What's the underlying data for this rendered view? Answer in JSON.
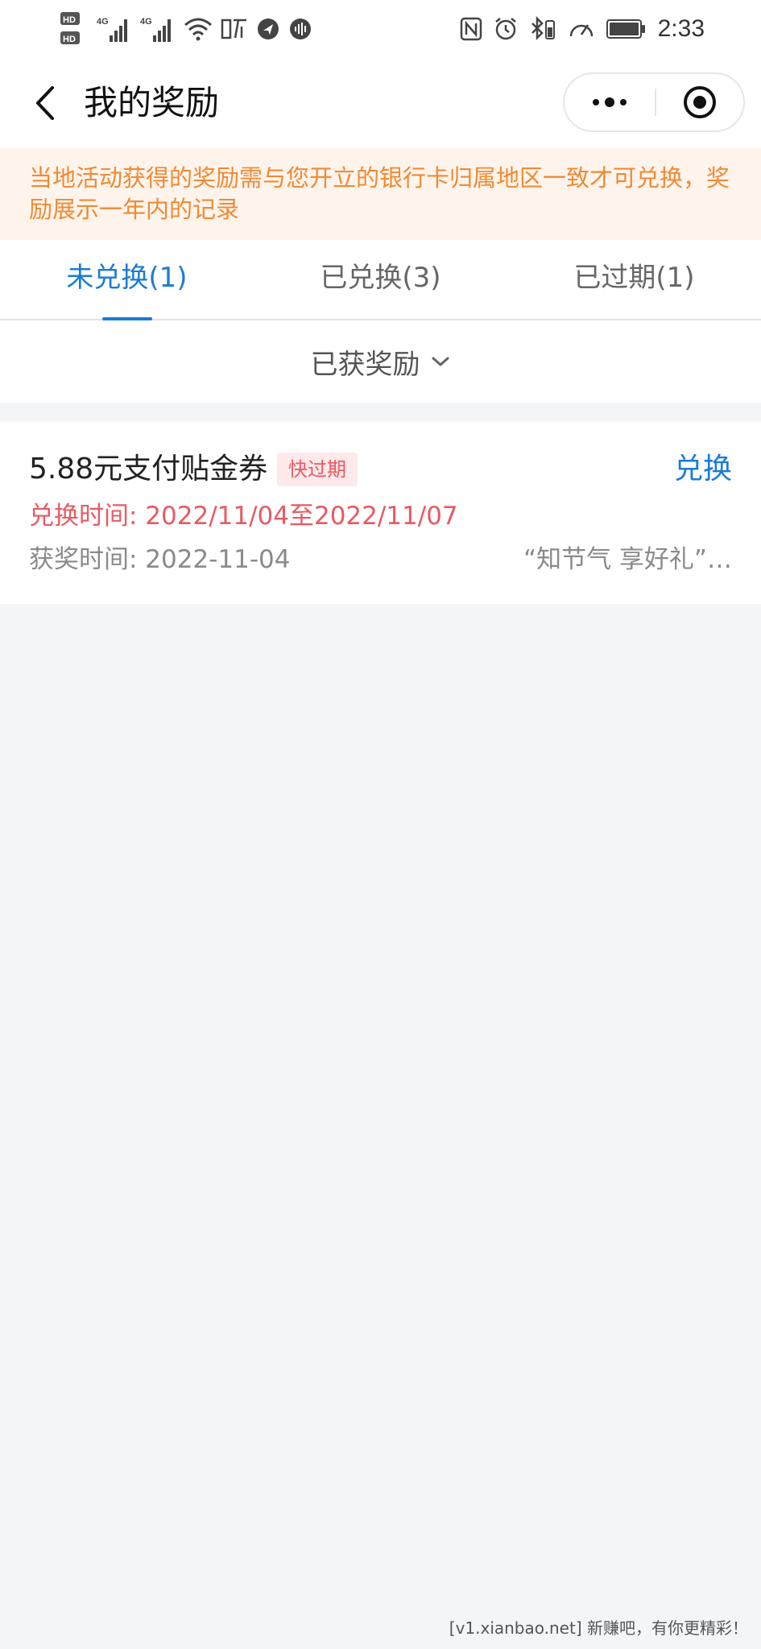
{
  "status_bar": {
    "time": "2:33",
    "signal_labels": [
      "HD",
      "HD"
    ],
    "network_labels": [
      "4G",
      "4G"
    ]
  },
  "nav": {
    "title": "我的奖励"
  },
  "notice": {
    "text": "当地活动获得的奖励需与您开立的银行卡归属地区一致才可兑换，奖励展示一年内的记录"
  },
  "tabs": [
    {
      "label": "未兑换(1)",
      "active": true
    },
    {
      "label": "已兑换(3)",
      "active": false
    },
    {
      "label": "已过期(1)",
      "active": false
    }
  ],
  "filter": {
    "label": "已获奖励"
  },
  "rewards": [
    {
      "title": "5.88元支付贴金券",
      "badge": "快过期",
      "action": "兑换",
      "redeem_time": "兑换时间: 2022/11/04至2022/11/07",
      "award_time": "获奖时间: 2022-11-04",
      "activity": "“知节气 享好礼”…"
    }
  ],
  "watermark": "[v1.xianbao.net] 新赚吧，有你更精彩！",
  "colors": {
    "accent": "#1a7bd6",
    "warning": "#e85a63",
    "notice_text": "#f08a33",
    "notice_bg": "#fff4ec",
    "page_bg": "#f4f5f7"
  }
}
